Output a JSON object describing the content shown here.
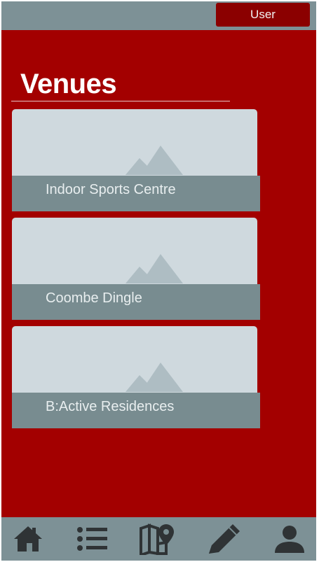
{
  "header": {
    "user_label": "User"
  },
  "page": {
    "title": "Venues"
  },
  "venues": [
    {
      "name": "Indoor Sports Centre"
    },
    {
      "name": "Coombe Dingle"
    },
    {
      "name": "B:Active Residences"
    }
  ],
  "bottom_nav": {
    "items": [
      {
        "icon": "home-icon"
      },
      {
        "icon": "list-icon"
      },
      {
        "icon": "map-pin-icon"
      },
      {
        "icon": "pencil-icon"
      },
      {
        "icon": "person-icon"
      }
    ]
  },
  "colors": {
    "background": "#a30000",
    "bar": "#7d9196",
    "user_button": "#8b0000",
    "card_image": "#cfd9de",
    "card_band": "#788c90",
    "icon_dark": "#2f3335"
  }
}
